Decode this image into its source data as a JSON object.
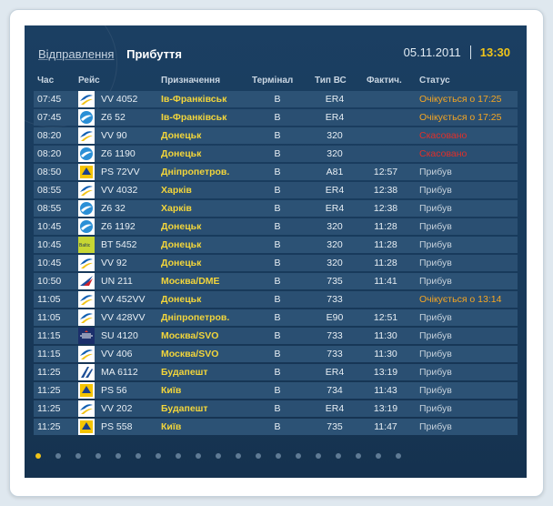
{
  "tabs": {
    "departures": "Відправлення",
    "arrivals": "Прибуття"
  },
  "date": "05.11.2011",
  "time": "13:30",
  "headers": {
    "time": "Час",
    "flight": "Рейс",
    "destination": "Призначення",
    "terminal": "Термінал",
    "type": "Тип ВС",
    "actual": "Фактич.",
    "status": "Статус"
  },
  "colors": {
    "accent": "#f0c419",
    "delayed": "#f5a623",
    "cancelled": "#e0302a"
  },
  "rows": [
    {
      "time": "07:45",
      "logo": "dniproavia-logo",
      "flight": "VV 4052",
      "dest": "Ів-Франківськ",
      "term": "B",
      "type": "ER4",
      "fact": "",
      "status": "Очікується о 17:25",
      "st": "delay"
    },
    {
      "time": "07:45",
      "logo": "aerosvit-logo",
      "flight": "Z6 52",
      "dest": "Ів-Франківськ",
      "term": "B",
      "type": "ER4",
      "fact": "",
      "status": "Очікується о 17:25",
      "st": "delay"
    },
    {
      "time": "08:20",
      "logo": "dniproavia-logo",
      "flight": "VV 90",
      "dest": "Донецьк",
      "term": "B",
      "type": "320",
      "fact": "",
      "status": "Скасовано",
      "st": "cancel"
    },
    {
      "time": "08:20",
      "logo": "aerosvit-logo",
      "flight": "Z6 1190",
      "dest": "Донецьк",
      "term": "B",
      "type": "320",
      "fact": "",
      "status": "Скасовано",
      "st": "cancel"
    },
    {
      "time": "08:50",
      "logo": "uia-logo",
      "flight": "PS 72VV",
      "dest": "Дніпропетров.",
      "term": "B",
      "type": "A81",
      "fact": "12:57",
      "status": "Прибув",
      "st": "arr"
    },
    {
      "time": "08:55",
      "logo": "dniproavia-logo",
      "flight": "VV 4032",
      "dest": "Харків",
      "term": "B",
      "type": "ER4",
      "fact": "12:38",
      "status": "Прибув",
      "st": "arr"
    },
    {
      "time": "08:55",
      "logo": "aerosvit-logo",
      "flight": "Z6 32",
      "dest": "Харків",
      "term": "B",
      "type": "ER4",
      "fact": "12:38",
      "status": "Прибув",
      "st": "arr"
    },
    {
      "time": "10:45",
      "logo": "aerosvit-logo",
      "flight": "Z6 1192",
      "dest": "Донецьк",
      "term": "B",
      "type": "320",
      "fact": "11:28",
      "status": "Прибув",
      "st": "arr"
    },
    {
      "time": "10:45",
      "logo": "airbaltic-logo",
      "flight": "BT 5452",
      "dest": "Донецьк",
      "term": "B",
      "type": "320",
      "fact": "11:28",
      "status": "Прибув",
      "st": "arr"
    },
    {
      "time": "10:45",
      "logo": "dniproavia-logo",
      "flight": "VV 92",
      "dest": "Донецьк",
      "term": "B",
      "type": "320",
      "fact": "11:28",
      "status": "Прибув",
      "st": "arr"
    },
    {
      "time": "10:50",
      "logo": "transaero-logo",
      "flight": "UN 211",
      "dest": "Москва/DME",
      "term": "B",
      "type": "735",
      "fact": "11:41",
      "status": "Прибув",
      "st": "arr"
    },
    {
      "time": "11:05",
      "logo": "dniproavia-logo",
      "flight": "VV 452VV",
      "dest": "Донецьк",
      "term": "B",
      "type": "733",
      "fact": "",
      "status": "Очікується о 13:14",
      "st": "delay"
    },
    {
      "time": "11:05",
      "logo": "dniproavia-logo",
      "flight": "VV 428VV",
      "dest": "Дніпропетров.",
      "term": "B",
      "type": "E90",
      "fact": "12:51",
      "status": "Прибув",
      "st": "arr"
    },
    {
      "time": "11:15",
      "logo": "aeroflot-logo",
      "flight": "SU 4120",
      "dest": "Москва/SVO",
      "term": "B",
      "type": "733",
      "fact": "11:30",
      "status": "Прибув",
      "st": "arr"
    },
    {
      "time": "11:15",
      "logo": "dniproavia-logo",
      "flight": "VV 406",
      "dest": "Москва/SVO",
      "term": "B",
      "type": "733",
      "fact": "11:30",
      "status": "Прибув",
      "st": "arr"
    },
    {
      "time": "11:25",
      "logo": "malev-logo",
      "flight": "MA 6112",
      "dest": "Будапешт",
      "term": "B",
      "type": "ER4",
      "fact": "13:19",
      "status": "Прибув",
      "st": "arr"
    },
    {
      "time": "11:25",
      "logo": "uia-logo",
      "flight": "PS 56",
      "dest": "Київ",
      "term": "B",
      "type": "734",
      "fact": "11:43",
      "status": "Прибув",
      "st": "arr"
    },
    {
      "time": "11:25",
      "logo": "dniproavia-logo",
      "flight": "VV 202",
      "dest": "Будапешт",
      "term": "B",
      "type": "ER4",
      "fact": "13:19",
      "status": "Прибув",
      "st": "arr"
    },
    {
      "time": "11:25",
      "logo": "uia-logo",
      "flight": "PS 558",
      "dest": "Київ",
      "term": "B",
      "type": "735",
      "fact": "11:47",
      "status": "Прибув",
      "st": "arr"
    }
  ],
  "pagination": {
    "total_pages": 19,
    "current_page": 1
  }
}
